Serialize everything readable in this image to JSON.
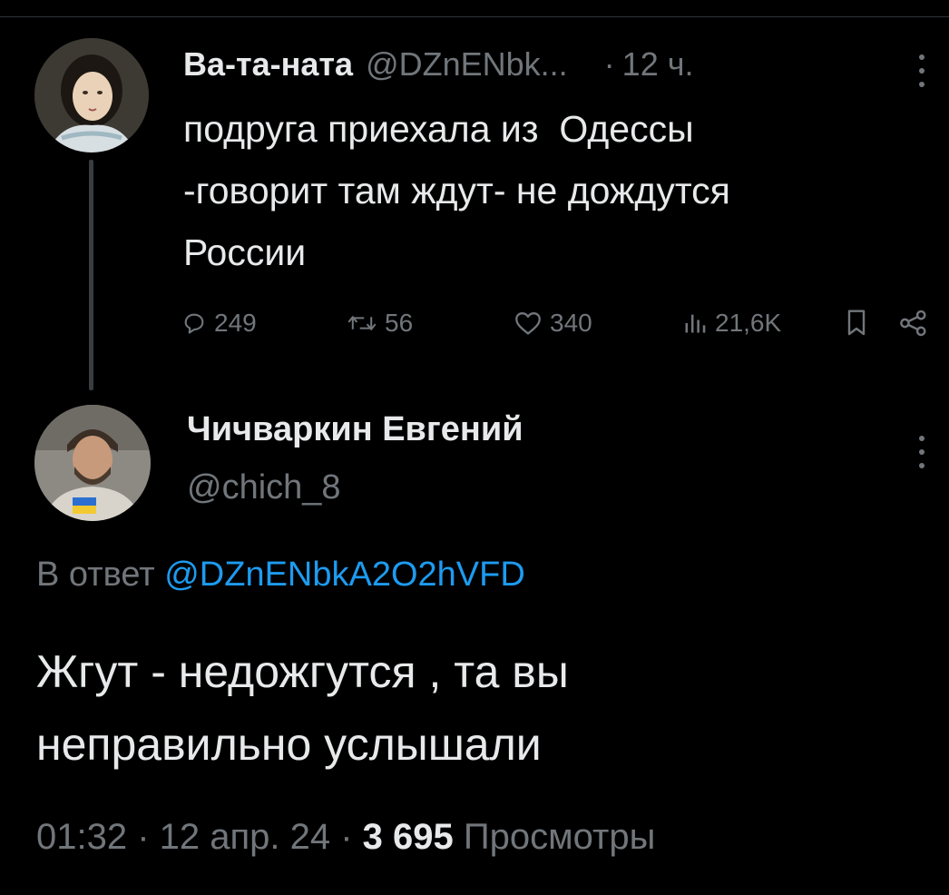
{
  "tweet1": {
    "name": "Ва-та-ната",
    "handle": "@DZnENbk...",
    "separator": "·",
    "time": "12 ч.",
    "text": "подруга приехала из  Одессы\n-говорит там ждут- не дождутся\nРоссии",
    "actions": {
      "replies": "249",
      "retweets": "56",
      "likes": "340",
      "views": "21,6K"
    }
  },
  "tweet2": {
    "name": "Чичваркин Евгений",
    "handle": "@chich_8",
    "reply_prefix": "В ответ",
    "reply_mention": "@DZnENbkA2O2hVFD",
    "text": "Жгут - недожгутся , та вы\nнеправильно услышали",
    "meta": {
      "time_date": "01:32 · 12 апр. 24 · ",
      "views_count": "3 695",
      "views_label": " Просмотры"
    }
  },
  "colors": {
    "background": "#000000",
    "text": "#e7e9ea",
    "muted": "#71767b",
    "link": "#1d9bf0"
  },
  "icons": [
    "reply-icon",
    "retweet-icon",
    "like-icon",
    "views-icon",
    "bookmark-icon",
    "share-icon",
    "more-icon"
  ]
}
